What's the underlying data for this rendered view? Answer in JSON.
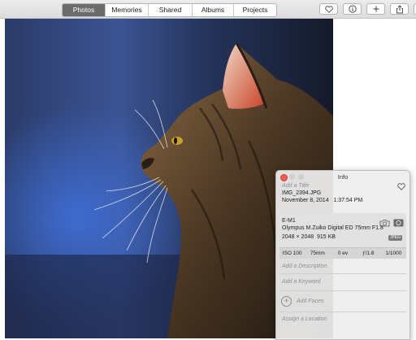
{
  "toolbar": {
    "tabs": [
      {
        "label": "Photos",
        "active": true
      },
      {
        "label": "Memories",
        "active": false
      },
      {
        "label": "Shared",
        "active": false
      },
      {
        "label": "Albums",
        "active": false
      },
      {
        "label": "Projects",
        "active": false
      }
    ],
    "buttons": [
      {
        "icon": "heart-icon"
      },
      {
        "icon": "info-icon"
      },
      {
        "icon": "plus-icon"
      },
      {
        "icon": "share-icon"
      },
      {
        "icon": "rotate-icon"
      }
    ]
  },
  "photo": {
    "subject": "cat-profile-photo"
  },
  "info_panel": {
    "window_title": "Info",
    "title_placeholder": "Add a Title",
    "filename": "IMG_2394.JPG",
    "date": "November 8, 2014",
    "time": "1:37:54 PM",
    "camera": "E-M1",
    "lens": "Olympus M.Zuiko Digital ED 75mm F1.8",
    "dimensions": "2048 × 2048",
    "file_size": "915 KB",
    "format_badge": "JPEG",
    "exif": {
      "iso": "ISO 100",
      "focal_length": "75mm",
      "exposure_bias": "0 ev",
      "aperture": "ƒ/1.8",
      "shutter": "1/1000"
    },
    "description_placeholder": "Add a Description",
    "keyword_placeholder": "Add a Keyword",
    "faces_placeholder": "Add Faces",
    "location_placeholder": "Assign a Location",
    "colors": {
      "close_button": "#f45a54",
      "active_tab": "#6b6b6b"
    }
  }
}
